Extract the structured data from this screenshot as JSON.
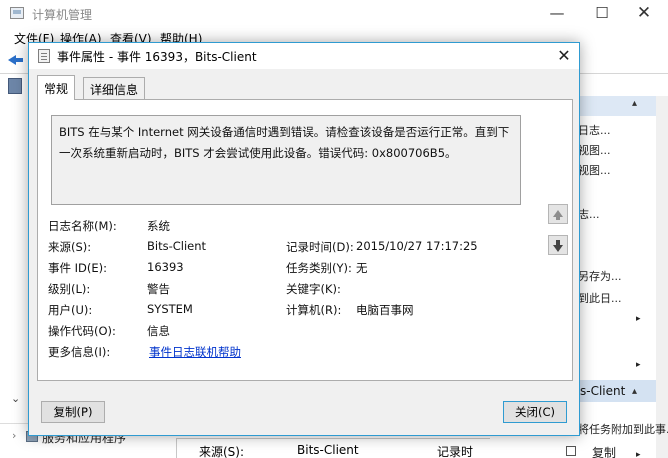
{
  "background_window": {
    "title": "计算机管理",
    "controls": {
      "minimize": "—",
      "maximize": "☐",
      "close": "✕"
    },
    "menu": {
      "file": "文件(F)",
      "action": "操作(A)",
      "view": "查看(V)",
      "help": "帮助(H)"
    },
    "tree": {
      "expand_glyph": "⌄",
      "services_arrow": "›",
      "services_label": "服务和应用程序"
    },
    "list_peek": {
      "source_label": "来源(S):",
      "source_value": "Bits-Client",
      "record_time_label": "记录时"
    },
    "actions": {
      "items": [
        "日志...",
        "视图...",
        "视图...",
        "志...",
        "另存为...",
        "到此日...",
        "将任务附加到此事..."
      ],
      "arrow_glyph": "▸",
      "collapse_glyph": "▴",
      "bits_header": "s-Client",
      "copy_label": "复制"
    }
  },
  "dialog": {
    "title": "事件属性 - 事件 16393，Bits-Client",
    "close_glyph": "✕",
    "tabs": {
      "general": "常规",
      "details": "详细信息"
    },
    "description": "BITS 在与某个 Internet 网关设备通信时遇到错误。请检查该设备是否运行正常。直到下一次系统重新启动时，BITS 才会尝试使用此设备。错误代码: 0x800706B5。",
    "fields": {
      "log_name": {
        "label": "日志名称(M):",
        "value": "系统"
      },
      "source": {
        "label": "来源(S):",
        "value": "Bits-Client"
      },
      "event_id": {
        "label": "事件 ID(E):",
        "value": "16393"
      },
      "level": {
        "label": "级别(L):",
        "value": "警告"
      },
      "user": {
        "label": "用户(U):",
        "value": "SYSTEM"
      },
      "opcode": {
        "label": "操作代码(O):",
        "value": "信息"
      },
      "more_info": {
        "label": "更多信息(I):",
        "value": "事件日志联机帮助"
      },
      "logged": {
        "label": "记录时间(D):",
        "value": "2015/10/27 17:17:25"
      },
      "task_category": {
        "label": "任务类别(Y):",
        "value": "无"
      },
      "keywords": {
        "label": "关键字(K):",
        "value": ""
      },
      "computer": {
        "label": "计算机(R):",
        "value": "电脑百事网"
      }
    },
    "buttons": {
      "copy": "复制(P)",
      "close": "关闭(C)"
    }
  },
  "colors": {
    "accent": "#2f9bd1",
    "link": "#0033cc",
    "selection": "#d4e2f2"
  }
}
